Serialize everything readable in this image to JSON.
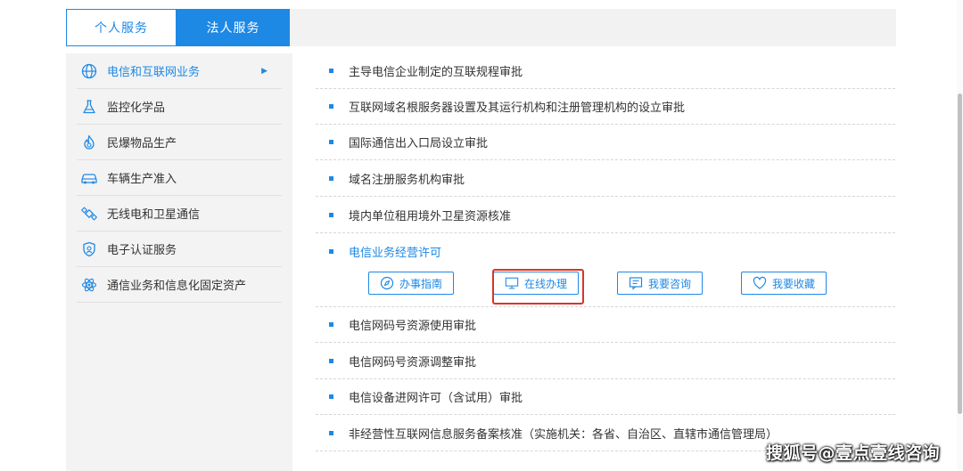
{
  "tabs": {
    "personal": "个人服务",
    "corporate": "法人服务"
  },
  "sidebar": {
    "items": [
      {
        "label": "电信和互联网业务",
        "icon": "globe-icon"
      },
      {
        "label": "监控化学品",
        "icon": "flask-icon"
      },
      {
        "label": "民爆物品生产",
        "icon": "flame-icon"
      },
      {
        "label": "车辆生产准入",
        "icon": "car-icon"
      },
      {
        "label": "无线电和卫星通信",
        "icon": "satellite-icon"
      },
      {
        "label": "电子认证服务",
        "icon": "shield-icon"
      },
      {
        "label": "通信业务和信息化固定资产",
        "icon": "atom-icon"
      }
    ]
  },
  "main": {
    "items_top": [
      "主导电信企业制定的互联规程审批",
      "互联网域名根服务器设置及其运行机构和注册管理机构的设立审批",
      "国际通信出入口局设立审批",
      "域名注册服务机构审批",
      "境内单位租用境外卫星资源核准"
    ],
    "active_item": "电信业务经营许可",
    "actions": {
      "guide": "办事指南",
      "online": "在线办理",
      "consult": "我要咨询",
      "favorite": "我要收藏"
    },
    "items_bottom": [
      "电信网码号资源使用审批",
      "电信网码号资源调整审批",
      "电信设备进网许可（含试用）审批",
      "非经营性互联网信息服务备案核准（实施机关：各省、自治区、直辖市通信管理局）"
    ]
  },
  "watermark": "搜狐号@壹点壹线咨询",
  "colors": {
    "accent": "#1e88e5",
    "highlight": "#d9342b"
  }
}
